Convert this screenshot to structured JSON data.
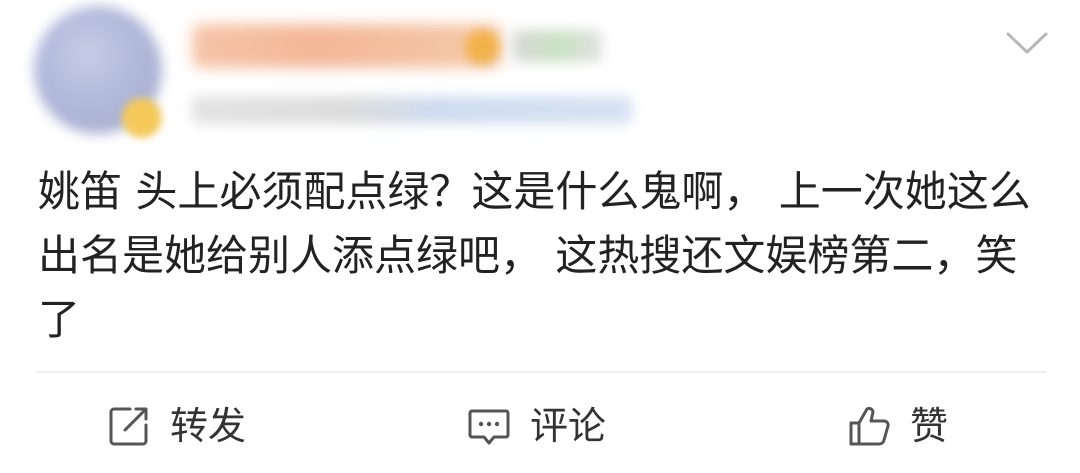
{
  "post": {
    "content": "姚笛 头上必须配点绿？这是什么鬼啊， 上一次她这么出名是她给别人添点绿吧， 这热搜还文娱榜第二，笑了"
  },
  "actions": {
    "repost": {
      "label": "转发",
      "icon": "share-icon"
    },
    "comment": {
      "label": "评论",
      "icon": "comment-icon"
    },
    "like": {
      "label": "赞",
      "icon": "thumbs-up-icon"
    }
  },
  "header": {
    "menu_icon": "chevron-down-icon"
  }
}
